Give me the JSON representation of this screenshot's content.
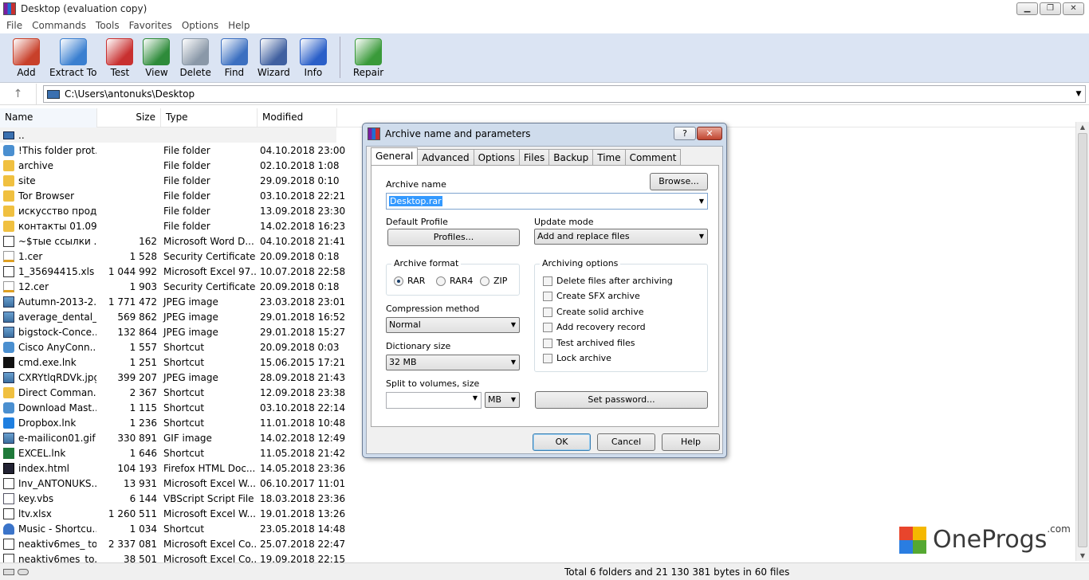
{
  "window": {
    "title": "Desktop (evaluation copy)",
    "btn_min": "▁",
    "btn_max": "❐",
    "btn_close": "✕"
  },
  "menu": [
    "File",
    "Commands",
    "Tools",
    "Favorites",
    "Options",
    "Help"
  ],
  "toolbar": [
    {
      "label": "Add",
      "icon": "add-archive-icon",
      "color": "#c8402a"
    },
    {
      "label": "Extract To",
      "icon": "extract-folder-icon",
      "color": "#3a7fd0"
    },
    {
      "label": "Test",
      "icon": "test-clipboard-icon",
      "color": "#c83030"
    },
    {
      "label": "View",
      "icon": "view-book-icon",
      "color": "#2e8b3a"
    },
    {
      "label": "Delete",
      "icon": "trash-icon",
      "color": "#8a98a8"
    },
    {
      "label": "Find",
      "icon": "magnifier-icon",
      "color": "#3b6fc0"
    },
    {
      "label": "Wizard",
      "icon": "wizard-wand-icon",
      "color": "#4060a0"
    },
    {
      "label": "Info",
      "icon": "info-icon",
      "color": "#2a5fc8"
    },
    {
      "label": "Repair",
      "icon": "repair-kit-icon",
      "color": "#3a9a3a"
    }
  ],
  "address": {
    "path": "C:\\Users\\antonuks\\Desktop"
  },
  "columns": {
    "name": "Name",
    "size": "Size",
    "type": "Type",
    "modified": "Modified"
  },
  "files": [
    {
      "name": "..",
      "size": "",
      "type": "",
      "modified": "",
      "icon": "up"
    },
    {
      "name": "!This folder prot...",
      "size": "",
      "type": "File folder",
      "modified": "04.10.2018 23:00",
      "icon": "lnk"
    },
    {
      "name": "archive",
      "size": "",
      "type": "File folder",
      "modified": "02.10.2018 1:08",
      "icon": "folder"
    },
    {
      "name": "site",
      "size": "",
      "type": "File folder",
      "modified": "29.09.2018 0:10",
      "icon": "folder"
    },
    {
      "name": "Tor Browser",
      "size": "",
      "type": "File folder",
      "modified": "03.10.2018 22:21",
      "icon": "folder"
    },
    {
      "name": "искусство прод...",
      "size": "",
      "type": "File folder",
      "modified": "13.09.2018 23:30",
      "icon": "folder"
    },
    {
      "name": "контакты 01.09....",
      "size": "",
      "type": "File folder",
      "modified": "14.02.2018 16:23",
      "icon": "folder"
    },
    {
      "name": "~$тые ссылки ...",
      "size": "162",
      "type": "Microsoft Word D...",
      "modified": "04.10.2018 21:41",
      "icon": "doc"
    },
    {
      "name": "1.cer",
      "size": "1 528",
      "type": "Security Certificate",
      "modified": "20.09.2018 0:18",
      "icon": "cert"
    },
    {
      "name": "1_35694415.xls",
      "size": "1 044 992",
      "type": "Microsoft Excel 97...",
      "modified": "10.07.2018 22:58",
      "icon": "doc"
    },
    {
      "name": "12.cer",
      "size": "1 903",
      "type": "Security Certificate",
      "modified": "20.09.2018 0:18",
      "icon": "cert"
    },
    {
      "name": "Autumn-2013-2...",
      "size": "1 771 472",
      "type": "JPEG image",
      "modified": "23.03.2018 23:01",
      "icon": "img"
    },
    {
      "name": "average_dental_...",
      "size": "569 862",
      "type": "JPEG image",
      "modified": "29.01.2018 16:52",
      "icon": "img"
    },
    {
      "name": "bigstock-Conce...",
      "size": "132 864",
      "type": "JPEG image",
      "modified": "29.01.2018 15:27",
      "icon": "img"
    },
    {
      "name": "Cisco AnyConn...",
      "size": "1 557",
      "type": "Shortcut",
      "modified": "20.09.2018 0:03",
      "icon": "lnk"
    },
    {
      "name": "cmd.exe.lnk",
      "size": "1 251",
      "type": "Shortcut",
      "modified": "15.06.2015 17:21",
      "icon": "cmd"
    },
    {
      "name": "CXRYtlqRDVk.jpg",
      "size": "399 207",
      "type": "JPEG image",
      "modified": "28.09.2018 21:43",
      "icon": "img"
    },
    {
      "name": "Direct Comman...",
      "size": "2 367",
      "type": "Shortcut",
      "modified": "12.09.2018 23:38",
      "icon": "folder"
    },
    {
      "name": "Download Mast...",
      "size": "1 115",
      "type": "Shortcut",
      "modified": "03.10.2018 22:14",
      "icon": "lnk"
    },
    {
      "name": "Dropbox.lnk",
      "size": "1 236",
      "type": "Shortcut",
      "modified": "11.01.2018 10:48",
      "icon": "dbx"
    },
    {
      "name": "e-mailicon01.gif",
      "size": "330 891",
      "type": "GIF image",
      "modified": "14.02.2018 12:49",
      "icon": "img"
    },
    {
      "name": "EXCEL.lnk",
      "size": "1 646",
      "type": "Shortcut",
      "modified": "11.05.2018 21:42",
      "icon": "xl"
    },
    {
      "name": "index.html",
      "size": "104 193",
      "type": "Firefox HTML Doc...",
      "modified": "14.05.2018 23:36",
      "icon": "html"
    },
    {
      "name": "Inv_ANTONUKS....",
      "size": "13 931",
      "type": "Microsoft Excel W...",
      "modified": "06.10.2017 11:01",
      "icon": "doc"
    },
    {
      "name": "key.vbs",
      "size": "6 144",
      "type": "VBScript Script File",
      "modified": "18.03.2018 23:36",
      "icon": "vbs"
    },
    {
      "name": "ltv.xlsx",
      "size": "1 260 511",
      "type": "Microsoft Excel W...",
      "modified": "19.01.2018 13:26",
      "icon": "doc"
    },
    {
      "name": "Music - Shortcu...",
      "size": "1 034",
      "type": "Shortcut",
      "modified": "23.05.2018 14:48",
      "icon": "music"
    },
    {
      "name": "neaktiv6mes_ to...",
      "size": "2 337 081",
      "type": "Microsoft Excel Co...",
      "modified": "25.07.2018 22:47",
      "icon": "doc"
    },
    {
      "name": "neaktiv6mes_to...",
      "size": "38 501",
      "type": "Microsoft Excel Co...",
      "modified": "19.09.2018 22:15",
      "icon": "doc"
    }
  ],
  "status": {
    "text": "Total 6 folders and 21 130 381 bytes in 60 files"
  },
  "logo": {
    "text": "OneProgs",
    "suffix": ".com",
    "colors": [
      "#e8452c",
      "#f5b800",
      "#2a7de1",
      "#55a832"
    ]
  },
  "dialog": {
    "title": "Archive name and parameters",
    "help": "?",
    "close": "✕",
    "tabs": [
      "General",
      "Advanced",
      "Options",
      "Files",
      "Backup",
      "Time",
      "Comment"
    ],
    "archive_name_label": "Archive name",
    "archive_name_value": "Desktop.rar",
    "browse": "Browse...",
    "default_profile_label": "Default Profile",
    "profiles": "Profiles...",
    "update_mode_label": "Update mode",
    "update_mode_value": "Add and replace files",
    "archive_format_label": "Archive format",
    "formats": [
      "RAR",
      "RAR4",
      "ZIP"
    ],
    "selected_format": "RAR",
    "compression_label": "Compression method",
    "compression_value": "Normal",
    "dictionary_label": "Dictionary size",
    "dictionary_value": "32 MB",
    "split_label": "Split to volumes, size",
    "split_value": "",
    "split_unit": "MB",
    "options_label": "Archiving options",
    "options": [
      "Delete files after archiving",
      "Create SFX archive",
      "Create solid archive",
      "Add recovery record",
      "Test archived files",
      "Lock archive"
    ],
    "set_password": "Set password...",
    "ok": "OK",
    "cancel": "Cancel",
    "help_btn": "Help"
  }
}
